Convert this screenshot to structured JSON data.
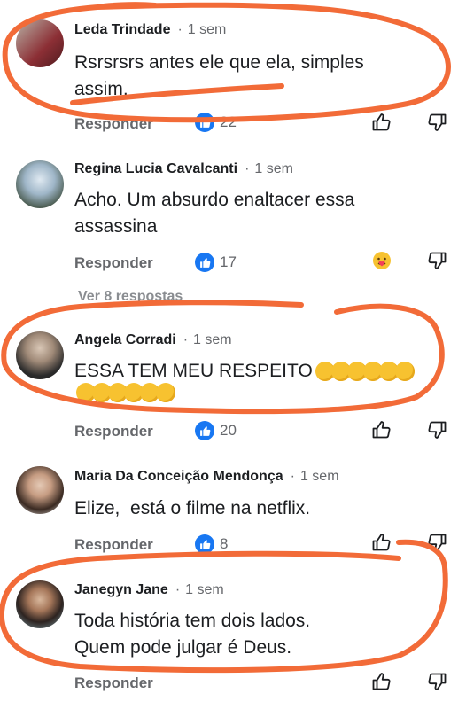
{
  "comments": [
    {
      "name": "Leda Trindade",
      "time": "1 sem",
      "text": "Rsrsrsrs antes ele que ela, simples assim.",
      "reply_label": "Responder",
      "likes": "22"
    },
    {
      "name": "Regina Lucia Cavalcanti",
      "time": "1 sem",
      "text": "Acho. Um absurdo enaltacer essa assassina",
      "reply_label": "Responder",
      "likes": "17"
    },
    {
      "name": "Angela Corradi",
      "time": "1 sem",
      "text": "ESSA TEM MEU RESPEITO",
      "reply_label": "Responder",
      "likes": "20"
    },
    {
      "name": "Maria Da Conceição Mendonça",
      "time": "1 sem",
      "text": "Elize,  está o filme na netflix.",
      "reply_label": "Responder",
      "likes": "8"
    },
    {
      "name": "Janegyn Jane",
      "time": "1 sem",
      "text": "Toda história tem dois lados. Quem pode julgar é Deus.",
      "reply_label": "Responder"
    }
  ],
  "replies_peek": "Ver 8 respostas",
  "separator": "·",
  "colors": {
    "annotation": "#f26b38",
    "like": "#1877f2",
    "secondary": "#65676b"
  }
}
